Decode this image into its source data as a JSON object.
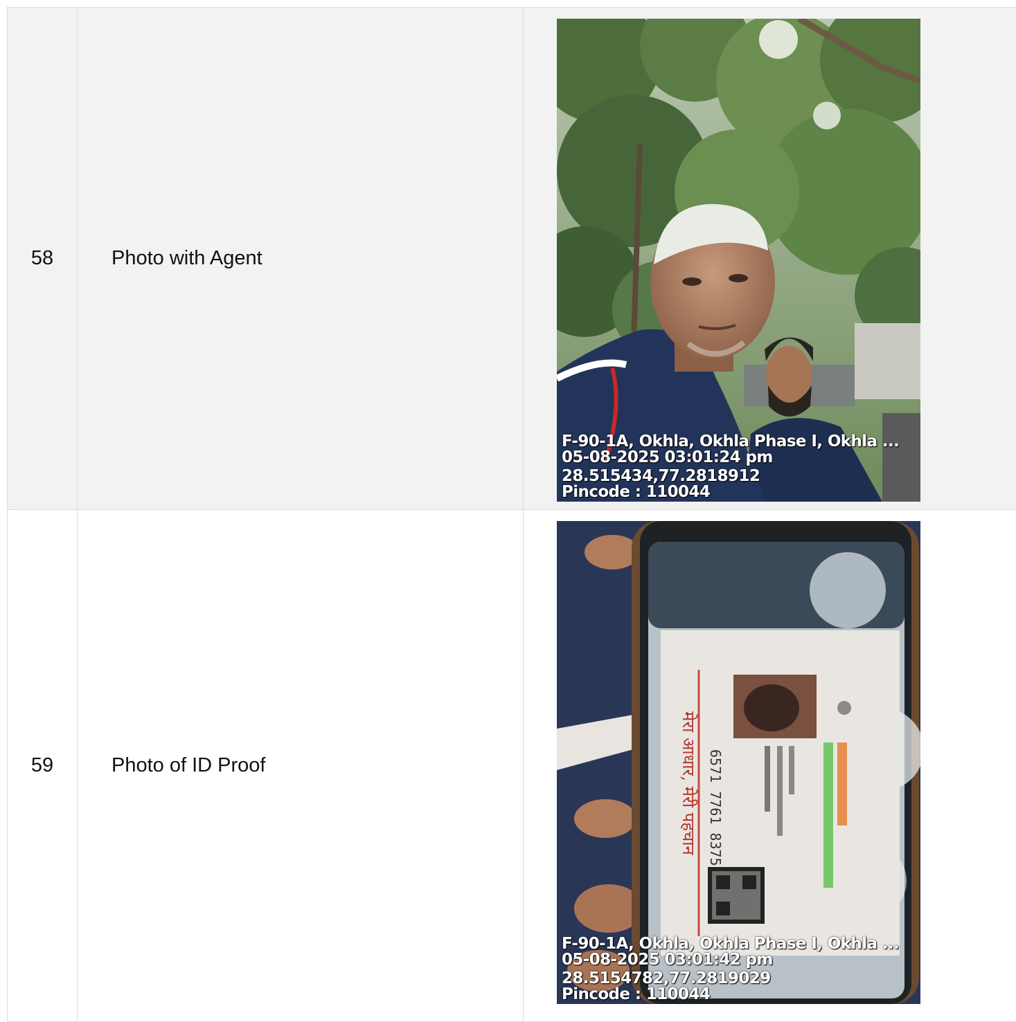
{
  "rows": [
    {
      "number": "58",
      "label": "Photo with Agent",
      "photo": {
        "icon": "photo-selfie-with-agent",
        "stamp": {
          "address": "F-90-1A, Okhla, Okhla Phase I, Okhla ...",
          "datetime": "05-08-2025 03:01:24 pm",
          "coordinates": "28.515434,77.2818912",
          "pincode": "Pincode : 110044"
        }
      }
    },
    {
      "number": "59",
      "label": "Photo of ID Proof",
      "photo": {
        "icon": "photo-id-card-on-phone",
        "card_number": "6571 7761 8375",
        "card_tagline": "मेरा आधार, मेरी पहचान",
        "stamp": {
          "address": "F-90-1A, Okhla, Okhla Phase I, Okhla ...",
          "datetime": "05-08-2025 03:01:42 pm",
          "coordinates": "28.5154782,77.2819029",
          "pincode": "Pincode : 110044"
        }
      }
    }
  ]
}
